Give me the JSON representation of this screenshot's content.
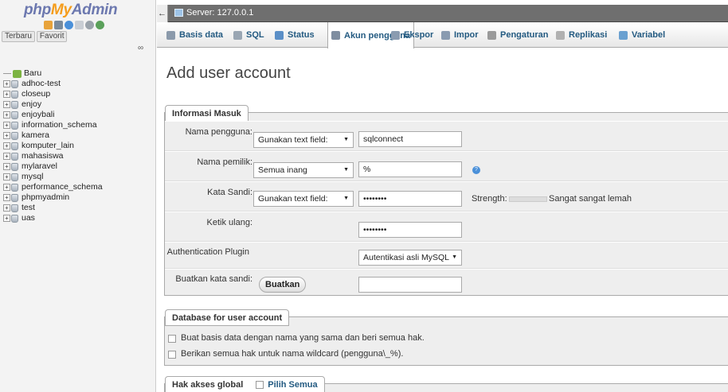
{
  "sidebar": {
    "logo": {
      "php": "php",
      "my": "My",
      "admin": "Admin"
    },
    "tabs": [
      "Terbaru",
      "Favorit"
    ],
    "tree_new": "Baru",
    "databases": [
      "adhoc-test",
      "closeup",
      "enjoy",
      "enjoybali",
      "information_schema",
      "kamera",
      "komputer_lain",
      "mahasiswa",
      "mylaravel",
      "mysql",
      "performance_schema",
      "phpmyadmin",
      "test",
      "uas"
    ]
  },
  "topbar": {
    "server": "Server: 127.0.0.1"
  },
  "menu": [
    {
      "label": "Basis data",
      "icon": "database-icon",
      "color": "#8b9aab"
    },
    {
      "label": "SQL",
      "icon": "sql-icon",
      "color": "#9aa6b3"
    },
    {
      "label": "Status",
      "icon": "status-icon",
      "color": "#5b8fc7"
    },
    {
      "label": "Akun pengguna",
      "icon": "users-icon",
      "color": "#7f8da0"
    },
    {
      "label": "Ekspor",
      "icon": "export-icon",
      "color": "#8a9bb0"
    },
    {
      "label": "Impor",
      "icon": "import-icon",
      "color": "#8a9bb0"
    },
    {
      "label": "Pengaturan",
      "icon": "wrench-icon",
      "color": "#9a9a9a"
    },
    {
      "label": "Replikasi",
      "icon": "replication-icon",
      "color": "#b0b0b0"
    },
    {
      "label": "Variabel",
      "icon": "variables-icon",
      "color": "#6aa0d0"
    }
  ],
  "page": {
    "title": "Add user account"
  },
  "login": {
    "legend": "Informasi Masuk",
    "username_label": "Nama pengguna:",
    "username_select": "Gunakan text field:",
    "username_value": "sqlconnect",
    "host_label": "Nama pemilik:",
    "host_select": "Semua inang",
    "host_value": "%",
    "password_label": "Kata Sandi:",
    "password_select": "Gunakan text field:",
    "password_value": "••••••••",
    "strength_label": "Strength:",
    "strength_text": "Sangat sangat lemah",
    "retype_label": "Ketik ulang:",
    "retype_value": "••••••••",
    "plugin_label": "Authentication Plugin",
    "plugin_value": "Autentikasi asli MySQL",
    "generate_label": "Buatkan kata sandi:",
    "generate_button": "Buatkan"
  },
  "database": {
    "legend": "Database for user account",
    "option1": "Buat basis data dengan nama yang sama dan beri semua hak.",
    "option2": "Berikan semua hak untuk nama wildcard (pengguna\\_%)."
  },
  "global": {
    "legend": "Hak akses global",
    "select_all": "Pilih Semua"
  }
}
